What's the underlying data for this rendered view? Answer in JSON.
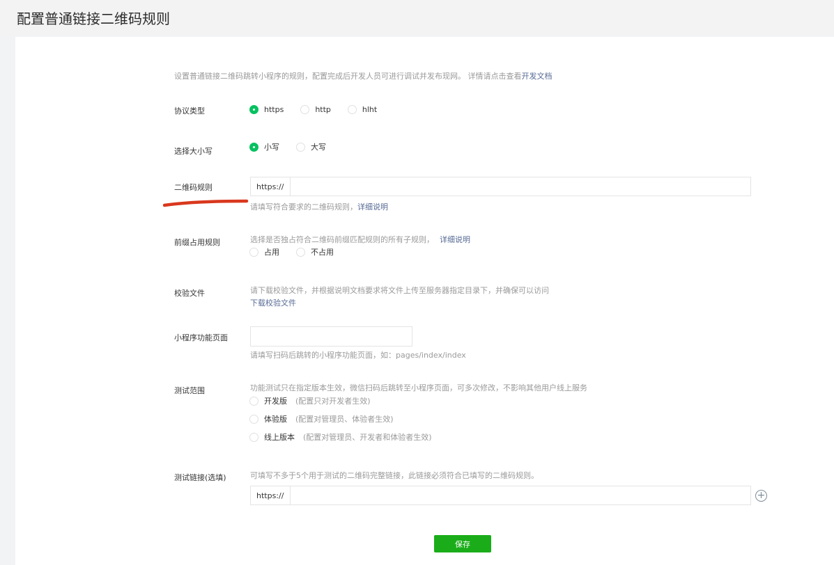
{
  "page": {
    "title": "配置普通链接二维码规则"
  },
  "intro": {
    "text": "设置普通链接二维码跳转小程序的规则，配置完成后开发人员可进行调试并发布现网。 详情请点击查看",
    "link": "开发文档"
  },
  "protocol": {
    "label": "协议类型",
    "options": [
      "https",
      "http",
      "hlht"
    ],
    "selected": "https"
  },
  "case": {
    "label": "选择大小写",
    "options": [
      "小写",
      "大写"
    ],
    "selected": "小写"
  },
  "qr_rule": {
    "label": "二维码规则",
    "prefix": "https://",
    "value": "",
    "hint": "请填写符合要求的二维码规则，",
    "hint_link": "详细说明"
  },
  "prefix_rule": {
    "label": "前缀占用规则",
    "hint": "选择是否独占符合二维码前缀匹配规则的所有子规则，",
    "hint_link": "详细说明",
    "options": [
      "占用",
      "不占用"
    ]
  },
  "verify_file": {
    "label": "校验文件",
    "hint": "请下载校验文件，并根据说明文档要求将文件上传至服务器指定目录下，并确保可以访问",
    "download_link": "下载校验文件"
  },
  "mini_page": {
    "label": "小程序功能页面",
    "value": "",
    "hint": "请填写扫码后跳转的小程序功能页面，如：pages/index/index"
  },
  "test_scope": {
    "label": "测试范围",
    "hint": "功能测试只在指定版本生效，微信扫码后跳转至小程序页面，可多次修改，不影响其他用户线上服务",
    "options": [
      {
        "name": "开发版",
        "desc": "(配置只对开发者生效)"
      },
      {
        "name": "体验版",
        "desc": "(配置对管理员、体验者生效)"
      },
      {
        "name": "线上版本",
        "desc": "(配置对管理员、开发者和体验者生效)"
      }
    ]
  },
  "test_link": {
    "label": "测试链接(选填)",
    "hint": "可填写不多于5个用于测试的二维码完整链接，此链接必须符合已填写的二维码规则。",
    "prefix": "https://",
    "value": "",
    "add_icon": "plus-circle-icon"
  },
  "save": {
    "label": "保存"
  },
  "colors": {
    "accent": "#07c160",
    "button": "#1aad19",
    "link": "#576b95",
    "annotation": "#d9381e"
  }
}
